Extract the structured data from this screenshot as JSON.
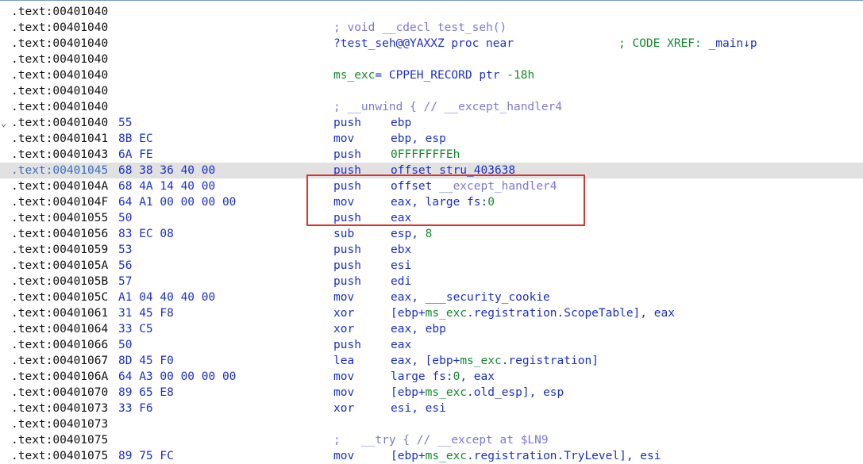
{
  "colors": {
    "address": "#111111",
    "bytes": "#1b2fcc",
    "mnemonic": "#1b2fcc",
    "number": "#138a2c",
    "comment": "#7b79d6",
    "highlight_row": "#e1e1e1",
    "annotation_box": "#e0312b"
  },
  "lines": [
    {
      "addr": ".text:00401040"
    },
    {
      "addr": ".text:00401040",
      "comment": "; void __cdecl test_seh()"
    },
    {
      "addr": ".text:00401040",
      "proc": "?test_seh@@YAXXZ proc near",
      "xref_label": "; CODE XREF: ",
      "xref_target": "_main↓p"
    },
    {
      "addr": ".text:00401040"
    },
    {
      "addr": ".text:00401040",
      "decl_name": "ms_exc",
      "decl_rest": "= CPPEH_RECORD ptr ",
      "decl_num": "-18h"
    },
    {
      "addr": ".text:00401040"
    },
    {
      "addr": ".text:00401040",
      "comment": "; __unwind { // __except_handler4"
    },
    {
      "addr": ".text:00401040",
      "chevron": "⌄",
      "bytes": "55",
      "mnem": "push",
      "ops": [
        {
          "t": "ebp",
          "c": "plain"
        }
      ]
    },
    {
      "addr": ".text:00401041",
      "bytes": "8B EC",
      "mnem": "mov",
      "ops": [
        {
          "t": "ebp, esp",
          "c": "plain"
        }
      ]
    },
    {
      "addr": ".text:00401043",
      "bytes": "6A FE",
      "mnem": "push",
      "ops": [
        {
          "t": "0FFFFFFFEh",
          "c": "num"
        }
      ]
    },
    {
      "addr": ".text:00401045",
      "bytes": "68 38 36 40 00",
      "mnem": "push",
      "highlight": true,
      "ops": [
        {
          "t": "offset stru_403638",
          "c": "plain"
        }
      ]
    },
    {
      "addr": ".text:0040104A",
      "bytes": "68 4A 14 40 00",
      "mnem": "push",
      "ops": [
        {
          "t": "offset ",
          "c": "plain"
        },
        {
          "t": "__except_handler4",
          "c": "sym"
        }
      ]
    },
    {
      "addr": ".text:0040104F",
      "bytes": "64 A1 00 00 00 00",
      "mnem": "mov",
      "ops": [
        {
          "t": "eax, large fs:",
          "c": "plain"
        },
        {
          "t": "0",
          "c": "num"
        }
      ]
    },
    {
      "addr": ".text:00401055",
      "bytes": "50",
      "mnem": "push",
      "ops": [
        {
          "t": "eax",
          "c": "plain"
        }
      ]
    },
    {
      "addr": ".text:00401056",
      "bytes": "83 EC 08",
      "mnem": "sub",
      "ops": [
        {
          "t": "esp, ",
          "c": "plain"
        },
        {
          "t": "8",
          "c": "num"
        }
      ]
    },
    {
      "addr": ".text:00401059",
      "bytes": "53",
      "mnem": "push",
      "ops": [
        {
          "t": "ebx",
          "c": "plain"
        }
      ]
    },
    {
      "addr": ".text:0040105A",
      "bytes": "56",
      "mnem": "push",
      "ops": [
        {
          "t": "esi",
          "c": "plain"
        }
      ]
    },
    {
      "addr": ".text:0040105B",
      "bytes": "57",
      "mnem": "push",
      "ops": [
        {
          "t": "edi",
          "c": "plain"
        }
      ]
    },
    {
      "addr": ".text:0040105C",
      "bytes": "A1 04 40 40 00",
      "mnem": "mov",
      "ops": [
        {
          "t": "eax, ___security_cookie",
          "c": "plain"
        }
      ]
    },
    {
      "addr": ".text:00401061",
      "bytes": "31 45 F8",
      "mnem": "xor",
      "ops": [
        {
          "t": "[ebp+",
          "c": "plain"
        },
        {
          "t": "ms_exc",
          "c": "num"
        },
        {
          "t": ".registration.ScopeTable], eax",
          "c": "plain"
        }
      ]
    },
    {
      "addr": ".text:00401064",
      "bytes": "33 C5",
      "mnem": "xor",
      "ops": [
        {
          "t": "eax, ebp",
          "c": "plain"
        }
      ]
    },
    {
      "addr": ".text:00401066",
      "bytes": "50",
      "mnem": "push",
      "ops": [
        {
          "t": "eax",
          "c": "plain"
        }
      ]
    },
    {
      "addr": ".text:00401067",
      "bytes": "8D 45 F0",
      "mnem": "lea",
      "ops": [
        {
          "t": "eax, [ebp+",
          "c": "plain"
        },
        {
          "t": "ms_exc",
          "c": "num"
        },
        {
          "t": ".registration]",
          "c": "plain"
        }
      ]
    },
    {
      "addr": ".text:0040106A",
      "bytes": "64 A3 00 00 00 00",
      "mnem": "mov",
      "ops": [
        {
          "t": "large fs:",
          "c": "plain"
        },
        {
          "t": "0",
          "c": "num"
        },
        {
          "t": ", eax",
          "c": "plain"
        }
      ]
    },
    {
      "addr": ".text:00401070",
      "bytes": "89 65 E8",
      "mnem": "mov",
      "ops": [
        {
          "t": "[ebp+",
          "c": "plain"
        },
        {
          "t": "ms_exc",
          "c": "num"
        },
        {
          "t": ".old_esp], esp",
          "c": "plain"
        }
      ]
    },
    {
      "addr": ".text:00401073",
      "bytes": "33 F6",
      "mnem": "xor",
      "ops": [
        {
          "t": "esi, esi",
          "c": "plain"
        }
      ]
    },
    {
      "addr": ".text:00401073"
    },
    {
      "addr": ".text:00401075",
      "comment": ";   __try { // __except at $LN9"
    },
    {
      "addr": ".text:00401075",
      "bytes": "89 75 FC",
      "mnem": "mov",
      "ops": [
        {
          "t": "[ebp+",
          "c": "plain"
        },
        {
          "t": "ms_exc",
          "c": "num"
        },
        {
          "t": ".registration.TryLevel], esi",
          "c": "plain"
        }
      ]
    }
  ]
}
